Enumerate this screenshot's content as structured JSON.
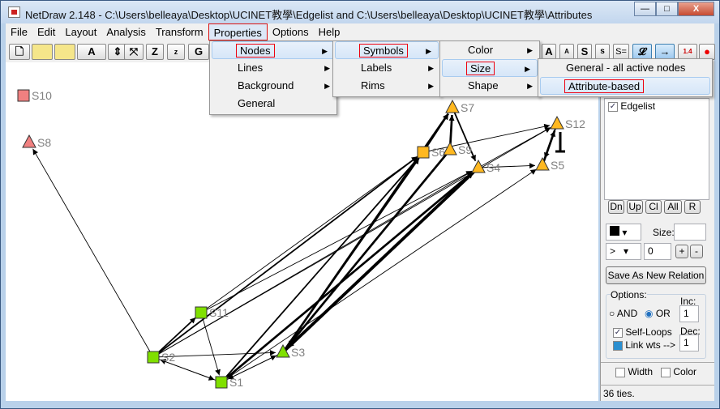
{
  "window": {
    "title": "NetDraw 2.148 - C:\\Users\\belleaya\\Desktop\\UCINET教學\\Edgelist and C:\\Users\\belleaya\\Desktop\\UCINET教學\\Attributes",
    "minimize": "—",
    "maximize": "□",
    "close": "X"
  },
  "menubar": [
    "File",
    "Edit",
    "Layout",
    "Analysis",
    "Transform",
    "Properties",
    "Options",
    "Help"
  ],
  "toolbar": {
    "left": [
      "",
      "",
      "",
      "A",
      "",
      "",
      "Z",
      "z",
      "G"
    ],
    "right": [
      "A",
      "A",
      "S",
      "s",
      "S=",
      "𝓛",
      "→",
      "1.4",
      "●"
    ]
  },
  "menus": {
    "properties": [
      {
        "label": "Nodes",
        "sub": true
      },
      {
        "label": "Lines",
        "sub": true
      },
      {
        "label": "Background",
        "sub": true
      },
      {
        "label": "General",
        "sub": false
      }
    ],
    "nodes": [
      {
        "label": "Symbols",
        "sub": true
      },
      {
        "label": "Labels",
        "sub": true
      },
      {
        "label": "Rims",
        "sub": true
      }
    ],
    "symbols": [
      {
        "label": "Color",
        "sub": true
      },
      {
        "label": "Size",
        "sub": true
      },
      {
        "label": "Shape",
        "sub": true
      }
    ],
    "size": [
      {
        "label": "General - all active nodes"
      },
      {
        "label": "Attribute-based"
      }
    ]
  },
  "network": {
    "nodes": [
      {
        "id": "S10",
        "shape": "square",
        "color": "#f08080"
      },
      {
        "id": "S8",
        "shape": "triangle",
        "color": "#f08080"
      },
      {
        "id": "S11",
        "shape": "square",
        "color": "#80e000"
      },
      {
        "id": "S2",
        "shape": "square",
        "color": "#80e000"
      },
      {
        "id": "S1",
        "shape": "square",
        "color": "#80e000"
      },
      {
        "id": "S3",
        "shape": "triangle",
        "color": "#80e000"
      },
      {
        "id": "S6",
        "shape": "square",
        "color": "#ffb820"
      },
      {
        "id": "S9",
        "shape": "triangle",
        "color": "#ffb820"
      },
      {
        "id": "S7",
        "shape": "triangle",
        "color": "#ffb820"
      },
      {
        "id": "S4",
        "shape": "triangle",
        "color": "#ffb820"
      },
      {
        "id": "S12",
        "shape": "triangle",
        "color": "#ffb820"
      },
      {
        "id": "S5",
        "shape": "triangle",
        "color": "#ffb820"
      }
    ],
    "edges": [
      [
        "S2",
        "S8",
        1
      ],
      [
        "S2",
        "S11",
        2
      ],
      [
        "S2",
        "S1",
        1
      ],
      [
        "S1",
        "S2",
        1
      ],
      [
        "S2",
        "S3",
        1
      ],
      [
        "S11",
        "S1",
        1
      ],
      [
        "S1",
        "S3",
        1
      ],
      [
        "S3",
        "S1",
        1
      ],
      [
        "S11",
        "S6",
        1
      ],
      [
        "S2",
        "S6",
        2
      ],
      [
        "S11",
        "S4",
        1
      ],
      [
        "S2",
        "S4",
        1
      ],
      [
        "S1",
        "S6",
        2
      ],
      [
        "S1",
        "S4",
        3
      ],
      [
        "S3",
        "S7",
        3
      ],
      [
        "S3",
        "S6",
        2
      ],
      [
        "S3",
        "S4",
        4
      ],
      [
        "S4",
        "S3",
        4
      ],
      [
        "S2",
        "S12",
        1
      ],
      [
        "S1",
        "S5",
        1
      ],
      [
        "S6",
        "S7",
        2
      ],
      [
        "S9",
        "S7",
        3
      ],
      [
        "S7",
        "S4",
        2
      ],
      [
        "S4",
        "S5",
        1
      ],
      [
        "S5",
        "S12",
        3
      ],
      [
        "S12",
        "S5",
        2
      ],
      [
        "S6",
        "S12",
        1
      ],
      [
        "S4",
        "S12",
        1
      ],
      [
        "S12",
        "S12",
        2
      ],
      [
        "S9",
        "S3",
        3
      ]
    ]
  },
  "side": {
    "relations": [
      {
        "label": "Edgelist",
        "checked": true
      }
    ],
    "buttons": [
      "Dn",
      "Up",
      "Cl",
      "All",
      "R"
    ],
    "size_label": "Size:",
    "size_value": "",
    "op": ">",
    "threshold": "0",
    "plus": "+",
    "minus": "-",
    "save": "Save As New Relation",
    "options_label": "Options:",
    "and": "AND",
    "or": "OR",
    "or_selected": true,
    "inc_label": "Inc:",
    "inc": "1",
    "dec_label": "Dec:",
    "dec": "1",
    "self_loops": "Self-Loops",
    "link_wts": "Link wts -->",
    "width": "Width",
    "color": "Color"
  },
  "status": "36 ties."
}
